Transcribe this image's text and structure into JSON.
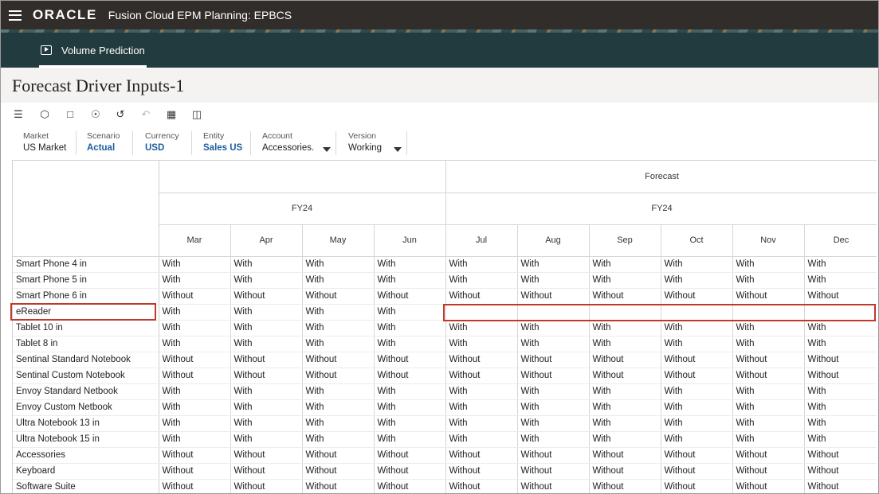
{
  "app": {
    "logo": "ORACLE",
    "title": "Fusion Cloud EPM Planning:  EPBCS"
  },
  "nav": {
    "tab_label": "Volume Prediction"
  },
  "page": {
    "title": "Forecast Driver Inputs-1"
  },
  "toolbar": {
    "icons": [
      "sliders-icon",
      "cube-icon",
      "comment-icon",
      "hierarchy-icon",
      "history-icon",
      "undo-icon",
      "grid-icon",
      "panel-icon"
    ]
  },
  "pov": {
    "market": {
      "label": "Market",
      "value": "US Market"
    },
    "scenario": {
      "label": "Scenario",
      "value": "Actual"
    },
    "currency": {
      "label": "Currency",
      "value": "USD"
    },
    "entity": {
      "label": "Entity",
      "value": "Sales US"
    },
    "account": {
      "label": "Account",
      "value": "Accessories."
    },
    "version": {
      "label": "Version",
      "value": "Working"
    }
  },
  "grid": {
    "scenario_header_right": "Forecast",
    "year_left": "FY24",
    "year_right": "FY24",
    "months": [
      "Mar",
      "Apr",
      "May",
      "Jun",
      "Jul",
      "Aug",
      "Sep",
      "Oct",
      "Nov",
      "Dec"
    ],
    "rows": [
      {
        "label": "Smart Phone 4 in",
        "values": [
          "With",
          "With",
          "With",
          "With",
          "With",
          "With",
          "With",
          "With",
          "With",
          "With"
        ]
      },
      {
        "label": "Smart Phone 5 in",
        "values": [
          "With",
          "With",
          "With",
          "With",
          "With",
          "With",
          "With",
          "With",
          "With",
          "With"
        ]
      },
      {
        "label": "Smart Phone 6 in",
        "values": [
          "Without",
          "Without",
          "Without",
          "Without",
          "Without",
          "Without",
          "Without",
          "Without",
          "Without",
          "Without"
        ]
      },
      {
        "label": "eReader",
        "values": [
          "With",
          "With",
          "With",
          "With",
          "",
          "",
          "",
          "",
          "",
          ""
        ]
      },
      {
        "label": "Tablet 10 in",
        "values": [
          "With",
          "With",
          "With",
          "With",
          "With",
          "With",
          "With",
          "With",
          "With",
          "With"
        ]
      },
      {
        "label": "Tablet 8 in",
        "values": [
          "With",
          "With",
          "With",
          "With",
          "With",
          "With",
          "With",
          "With",
          "With",
          "With"
        ]
      },
      {
        "label": "Sentinal Standard Notebook",
        "values": [
          "Without",
          "Without",
          "Without",
          "Without",
          "Without",
          "Without",
          "Without",
          "Without",
          "Without",
          "Without"
        ]
      },
      {
        "label": "Sentinal Custom Notebook",
        "values": [
          "Without",
          "Without",
          "Without",
          "Without",
          "Without",
          "Without",
          "Without",
          "Without",
          "Without",
          "Without"
        ]
      },
      {
        "label": "Envoy Standard Netbook",
        "values": [
          "With",
          "With",
          "With",
          "With",
          "With",
          "With",
          "With",
          "With",
          "With",
          "With"
        ]
      },
      {
        "label": "Envoy Custom Netbook",
        "values": [
          "With",
          "With",
          "With",
          "With",
          "With",
          "With",
          "With",
          "With",
          "With",
          "With"
        ]
      },
      {
        "label": "Ultra Notebook 13 in",
        "values": [
          "With",
          "With",
          "With",
          "With",
          "With",
          "With",
          "With",
          "With",
          "With",
          "With"
        ]
      },
      {
        "label": "Ultra Notebook 15 in",
        "values": [
          "With",
          "With",
          "With",
          "With",
          "With",
          "With",
          "With",
          "With",
          "With",
          "With"
        ]
      },
      {
        "label": "Accessories",
        "values": [
          "Without",
          "Without",
          "Without",
          "Without",
          "Without",
          "Without",
          "Without",
          "Without",
          "Without",
          "Without"
        ]
      },
      {
        "label": "Keyboard",
        "values": [
          "Without",
          "Without",
          "Without",
          "Without",
          "Without",
          "Without",
          "Without",
          "Without",
          "Without",
          "Without"
        ]
      },
      {
        "label": "Software Suite",
        "values": [
          "Without",
          "Without",
          "Without",
          "Without",
          "Without",
          "Without",
          "Without",
          "Without",
          "Without",
          "Without"
        ]
      }
    ]
  }
}
